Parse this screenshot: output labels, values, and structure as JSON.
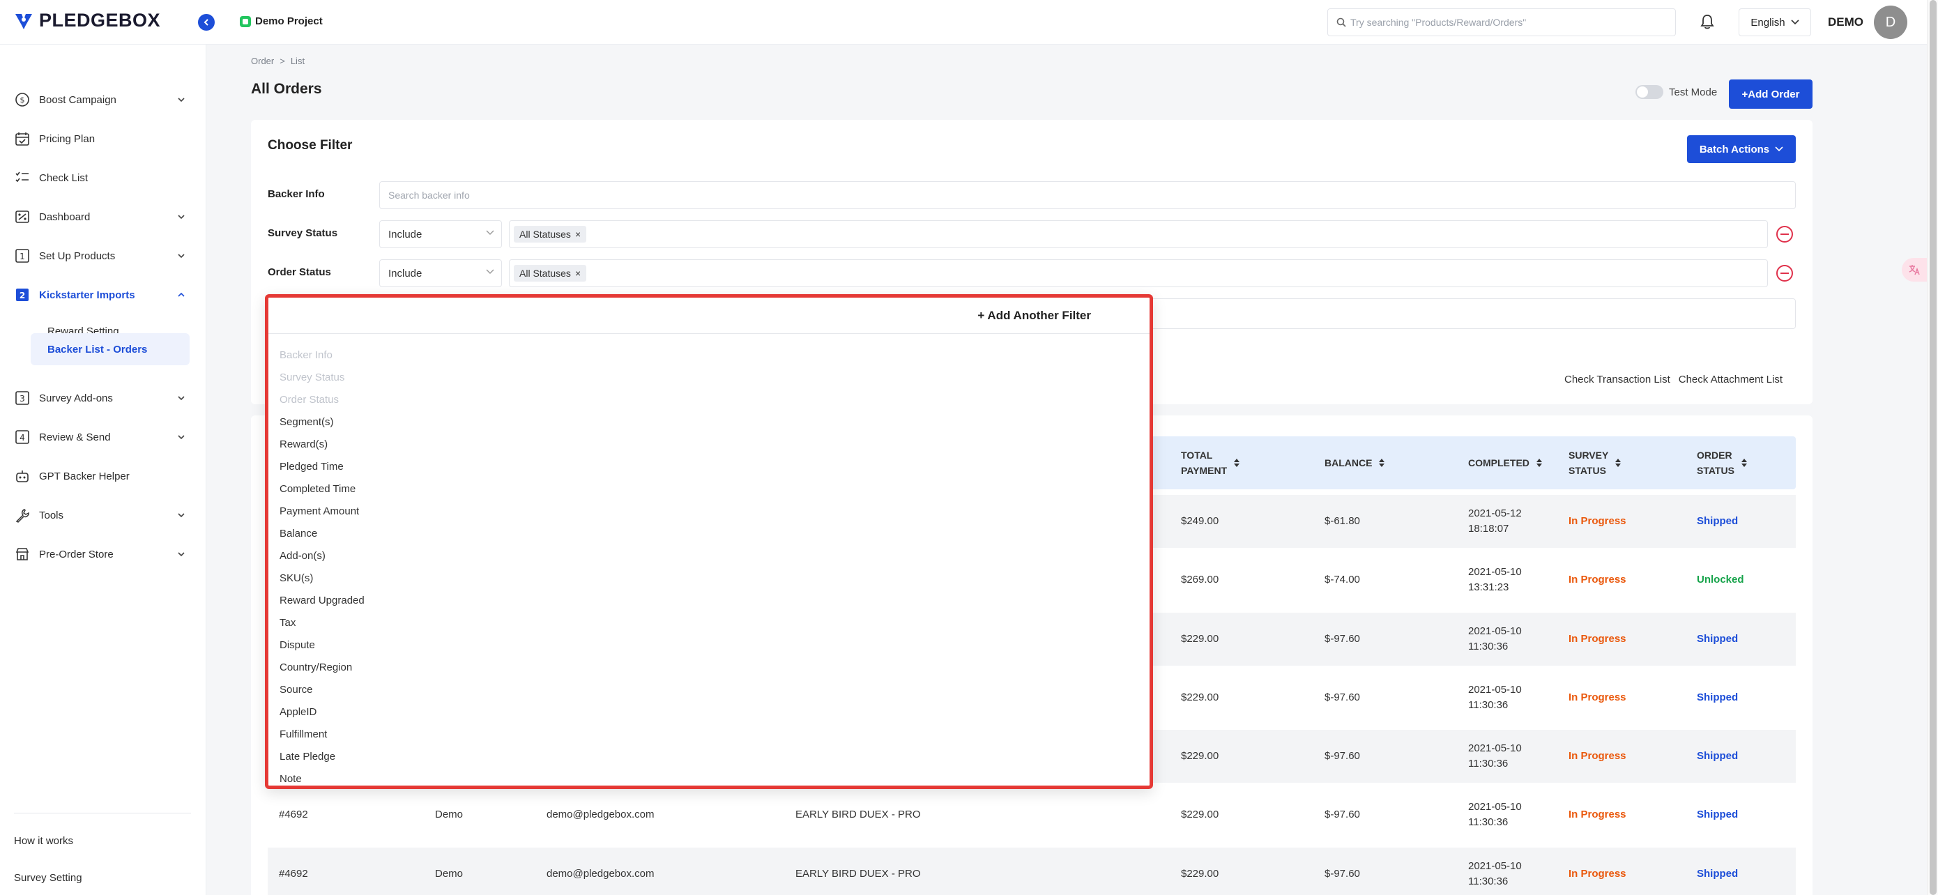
{
  "header": {
    "logo": "PLEDGEBOX",
    "project": "Demo Project",
    "search_placeholder": "Try searching \"Products/Reward/Orders\"",
    "language": "English",
    "user_name": "DEMO",
    "avatar_initial": "D",
    "accent_color": "#1d4ed8"
  },
  "sidebar": {
    "items": [
      {
        "label": "Boost Campaign",
        "icon": "coin-icon"
      },
      {
        "label": "Pricing Plan",
        "icon": "calendar-check-icon"
      },
      {
        "label": "Check List",
        "icon": "checklist-icon"
      },
      {
        "label": "Dashboard",
        "icon": "chart-percent-icon"
      },
      {
        "label": "Set Up Products",
        "icon": "step-1-icon"
      },
      {
        "label": "Kickstarter Imports",
        "icon": "step-2-icon"
      },
      {
        "label": "Survey Add-ons",
        "icon": "step-3-icon"
      },
      {
        "label": "Review & Send",
        "icon": "step-4-icon"
      },
      {
        "label": "GPT Backer Helper",
        "icon": "robot-icon"
      },
      {
        "label": "Tools",
        "icon": "wrench-icon"
      },
      {
        "label": "Pre-Order Store",
        "icon": "store-icon"
      }
    ],
    "sub_items": [
      "Reward Setting",
      "Backer List - Orders"
    ],
    "footer_links": [
      "How it works",
      "Survey Setting"
    ]
  },
  "page": {
    "breadcrumb": [
      "Order",
      ">",
      "List"
    ],
    "title": "All Orders",
    "test_mode_label": "Test Mode",
    "add_order_label": "+Add Order"
  },
  "filter": {
    "title": "Choose Filter",
    "batch_label": "Batch Actions",
    "backer_info_label": "Backer Info",
    "backer_info_placeholder": "Search backer info",
    "survey_status_label": "Survey Status",
    "order_status_label": "Order Status",
    "include_label": "Include",
    "all_statuses": "All Statuses",
    "check_transaction": "Check Transaction List",
    "check_attachment": "Check Attachment List"
  },
  "dropdown": {
    "add_filter_label": "+ Add Another Filter",
    "disabled_options": [
      "Backer Info",
      "Survey Status",
      "Order Status"
    ],
    "options": [
      "Segment(s)",
      "Reward(s)",
      "Pledged Time",
      "Completed Time",
      "Payment Amount",
      "Balance",
      "Add-on(s)",
      "SKU(s)",
      "Reward Upgraded",
      "Tax",
      "Dispute",
      "Country/Region",
      "Source",
      "AppleID",
      "Fulfillment",
      "Late Pledge",
      "Note"
    ]
  },
  "table": {
    "columns": {
      "total_payment": [
        "TOTAL",
        "PAYMENT"
      ],
      "balance": "BALANCE",
      "completed": "COMPLETED",
      "survey_status": [
        "SURVEY",
        "STATUS"
      ],
      "order_status": [
        "ORDER",
        "STATUS"
      ]
    },
    "rows": [
      {
        "total": "$249.00",
        "balance": "$-61.80",
        "date": "2021-05-12",
        "time": "18:18:07",
        "survey": "In Progress",
        "order": "Shipped"
      },
      {
        "total": "$269.00",
        "balance": "$-74.00",
        "date": "2021-05-10",
        "time": "13:31:23",
        "survey": "In Progress",
        "order": "Unlocked"
      },
      {
        "total": "$229.00",
        "balance": "$-97.60",
        "date": "2021-05-10",
        "time": "11:30:36",
        "survey": "In Progress",
        "order": "Shipped"
      },
      {
        "total": "$229.00",
        "balance": "$-97.60",
        "date": "2021-05-10",
        "time": "11:30:36",
        "survey": "In Progress",
        "order": "Shipped"
      },
      {
        "total": "$229.00",
        "balance": "$-97.60",
        "date": "2021-05-10",
        "time": "11:30:36",
        "survey": "In Progress",
        "order": "Shipped"
      },
      {
        "id": "#4692",
        "name": "Demo",
        "email": "demo@pledgebox.com",
        "reward": "EARLY BIRD DUEX - PRO",
        "total": "$229.00",
        "balance": "$-97.60",
        "date": "2021-05-10",
        "time": "11:30:36",
        "survey": "In Progress",
        "order": "Shipped"
      },
      {
        "id": "#4692",
        "name": "Demo",
        "email": "demo@pledgebox.com",
        "reward": "EARLY BIRD DUEX - PRO",
        "total": "$229.00",
        "balance": "$-97.60",
        "date": "2021-05-10",
        "time": "11:30:36",
        "survey": "In Progress",
        "order": "Shipped"
      }
    ]
  }
}
